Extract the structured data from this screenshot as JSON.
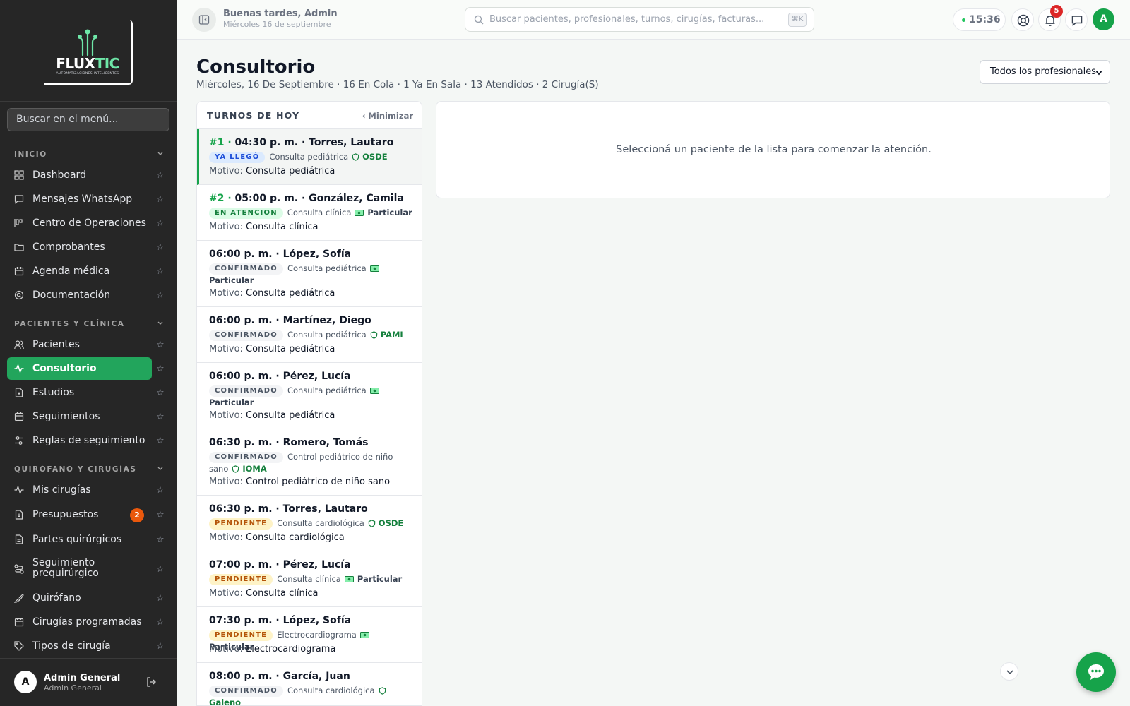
{
  "sidebar": {
    "menu_search_placeholder": "Buscar en el menú...",
    "sections": {
      "inicio": "INICIO",
      "pacientes": "PACIENTES Y CLÍNICA",
      "quirofano": "QUIRÓFANO Y CIRUGÍAS"
    },
    "items": {
      "dashboard": "Dashboard",
      "whatsapp": "Mensajes WhatsApp",
      "centro_ops": "Centro de Operaciones",
      "comprobantes": "Comprobantes",
      "agenda": "Agenda médica",
      "documentacion": "Documentación",
      "pacientes": "Pacientes",
      "consultorio": "Consultorio",
      "estudios": "Estudios",
      "seguimientos": "Seguimientos",
      "reglas": "Reglas de seguimiento",
      "mis_cirugias": "Mis cirugías",
      "presupuestos": "Presupuestos",
      "presupuestos_badge": "2",
      "partes": "Partes quirúrgicos",
      "seg_prequirurgico": "Seguimiento prequirúrgico",
      "quirofano": "Quirófano",
      "cirugias_prog": "Cirugías programadas",
      "tipos_cirugia": "Tipos de cirugía"
    },
    "footer": {
      "avatar_initial": "A",
      "name": "Admin General",
      "role": "Admin General"
    }
  },
  "topbar": {
    "greeting": "Buenas tardes, Admin",
    "date": "Miércoles 16 de septiembre",
    "search_placeholder": "Buscar pacientes, profesionales, turnos, cirugías, facturas...",
    "search_shortcut": "⌘K",
    "clock": "15:36",
    "notifications_count": "5",
    "user_initial": "A"
  },
  "main": {
    "title": "Consultorio",
    "subtitle": "Miércoles, 16 De Septiembre · 16 En Cola · 1 Ya En Sala · 13 Atendidos · 2 Cirugía(S)",
    "professional_filter": "Todos los profesionales",
    "queue_title": "TURNOS DE HOY",
    "minimize_label": "‹ Minimizar",
    "motivo_label": "Motivo:",
    "detail_empty": "Seleccioná un paciente de la lista para comenzar la atención."
  },
  "appointments": [
    {
      "num": "#1 ·",
      "time_name": "04:30 p. m. · Torres, Lautaro",
      "status": "YA LLEGÓ",
      "type": "Consulta pediátrica",
      "insurance": "OSDE",
      "motivo": "Consulta pediátrica"
    },
    {
      "num": "#2 ·",
      "time_name": "05:00 p. m. · González, Camila",
      "status": "EN ATENCION",
      "type": "Consulta clínica",
      "insurance": "Particular",
      "motivo": "Consulta clínica"
    },
    {
      "num": "",
      "time_name": "06:00 p. m. · López, Sofía",
      "status": "CONFIRMADO",
      "type": "Consulta pediátrica",
      "insurance": "Particular",
      "motivo": "Consulta pediátrica"
    },
    {
      "num": "",
      "time_name": "06:00 p. m. · Martínez, Diego",
      "status": "CONFIRMADO",
      "type": "Consulta pediátrica",
      "insurance": "PAMI",
      "motivo": "Consulta pediátrica"
    },
    {
      "num": "",
      "time_name": "06:00 p. m. · Pérez, Lucía",
      "status": "CONFIRMADO",
      "type": "Consulta pediátrica",
      "insurance": "Particular",
      "motivo": "Consulta pediátrica"
    },
    {
      "num": "",
      "time_name": "06:30 p. m. · Romero, Tomás",
      "status": "CONFIRMADO",
      "type": "Control pediátrico de niño sano",
      "insurance": "IOMA",
      "motivo": "Control pediátrico de niño sano"
    },
    {
      "num": "",
      "time_name": "06:30 p. m. · Torres, Lautaro",
      "status": "PENDIENTE",
      "type": "Consulta cardiológica",
      "insurance": "OSDE",
      "motivo": "Consulta cardiológica"
    },
    {
      "num": "",
      "time_name": "07:00 p. m. · Pérez, Lucía",
      "status": "PENDIENTE",
      "type": "Consulta clínica",
      "insurance": "Particular",
      "motivo": "Consulta clínica"
    },
    {
      "num": "",
      "time_name": "07:30 p. m. · López, Sofía",
      "status": "PENDIENTE",
      "type": "Electrocardiograma",
      "insurance": "Particular",
      "motivo": "Electrocardiograma"
    },
    {
      "num": "",
      "time_name": "08:00 p. m. · García, Juan",
      "status": "CONFIRMADO",
      "type": "Consulta cardiológica",
      "insurance": "Galeno",
      "motivo": ""
    }
  ],
  "colors": {
    "brand_green": "#16a34a",
    "sidebar_bg": "#262626",
    "active_item": "#22a55c",
    "badge_orange": "#ea580c",
    "notif_red": "#dc2626"
  },
  "icons": {
    "logo": "fluxtic-logo",
    "insurance_card": "shield-icon",
    "insurance_cash": "banknote-icon",
    "chat": "chat-bubble-icon"
  }
}
